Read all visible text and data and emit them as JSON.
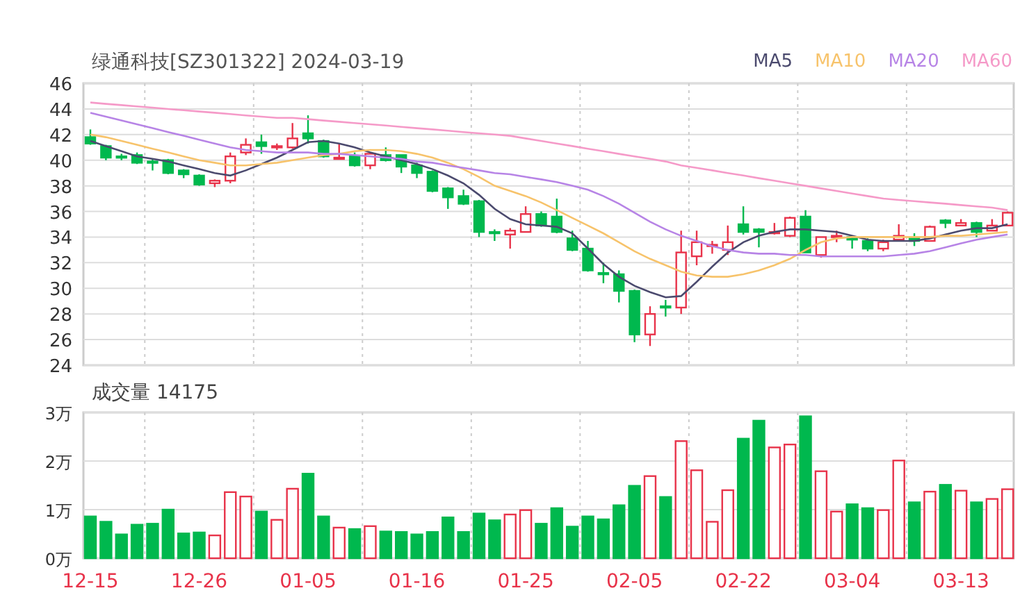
{
  "title": "绿通科技[SZ301322] 2024-03-19",
  "moving_averages": {
    "chart_data": {
      "type": "line",
      "ylim": [
        24,
        46
      ],
      "series": [
        {
          "name": "MA5",
          "color": "#4b4a6e",
          "values": [
            41.5,
            41.1,
            40.7,
            40.3,
            40.1,
            39.9,
            39.6,
            39.3,
            39.0,
            38.8,
            39.2,
            39.7,
            40.2,
            40.8,
            41.4,
            41.5,
            41.3,
            41.0,
            40.6,
            40.3,
            40.0,
            39.7,
            39.3,
            38.8,
            38.2,
            37.3,
            36.2,
            35.4,
            35.0,
            34.9,
            34.8,
            34.3,
            33.1,
            31.9,
            30.9,
            30.2,
            29.7,
            29.3,
            29.4,
            30.5,
            31.7,
            32.8,
            33.6,
            34.1,
            34.4,
            34.6,
            34.6,
            34.5,
            34.4,
            34.1,
            33.8,
            33.7,
            33.7,
            33.7,
            33.9,
            34.2,
            34.5,
            34.7,
            34.7,
            35.0
          ]
        },
        {
          "name": "MA10",
          "color": "#f7c36b",
          "values": [
            42.0,
            41.8,
            41.5,
            41.2,
            40.9,
            40.6,
            40.3,
            40.0,
            39.8,
            39.6,
            39.6,
            39.7,
            39.8,
            40.0,
            40.2,
            40.4,
            40.5,
            40.7,
            40.8,
            40.8,
            40.7,
            40.5,
            40.2,
            39.8,
            39.3,
            38.7,
            38.0,
            37.6,
            37.2,
            36.7,
            36.1,
            35.5,
            34.9,
            34.3,
            33.6,
            32.9,
            32.3,
            31.8,
            31.3,
            31.0,
            30.9,
            30.9,
            31.1,
            31.4,
            31.8,
            32.3,
            33.0,
            33.6,
            33.9,
            34.0,
            34.0,
            34.0,
            34.0,
            34.0,
            34.0,
            34.1,
            34.1,
            34.2,
            34.3,
            34.4
          ]
        },
        {
          "name": "MA20",
          "color": "#b784e6",
          "values": [
            43.7,
            43.4,
            43.1,
            42.8,
            42.5,
            42.2,
            41.9,
            41.6,
            41.3,
            41.0,
            40.8,
            40.7,
            40.6,
            40.6,
            40.6,
            40.5,
            40.5,
            40.4,
            40.3,
            40.2,
            40.1,
            39.9,
            39.8,
            39.6,
            39.4,
            39.2,
            39.0,
            38.9,
            38.7,
            38.5,
            38.3,
            38.0,
            37.7,
            37.2,
            36.6,
            35.9,
            35.2,
            34.6,
            34.1,
            33.7,
            33.3,
            33.0,
            32.8,
            32.7,
            32.7,
            32.6,
            32.6,
            32.5,
            32.5,
            32.5,
            32.5,
            32.5,
            32.6,
            32.7,
            32.9,
            33.2,
            33.5,
            33.8,
            34.0,
            34.2
          ]
        },
        {
          "name": "MA60",
          "color": "#f59ac8",
          "values": [
            44.5,
            44.4,
            44.3,
            44.2,
            44.1,
            44.0,
            43.9,
            43.8,
            43.7,
            43.6,
            43.5,
            43.4,
            43.3,
            43.3,
            43.2,
            43.1,
            43.0,
            42.9,
            42.8,
            42.7,
            42.6,
            42.5,
            42.4,
            42.3,
            42.2,
            42.1,
            42.0,
            41.9,
            41.7,
            41.5,
            41.3,
            41.1,
            40.9,
            40.7,
            40.5,
            40.3,
            40.1,
            39.9,
            39.6,
            39.4,
            39.2,
            39.0,
            38.8,
            38.6,
            38.4,
            38.2,
            38.0,
            37.8,
            37.6,
            37.4,
            37.2,
            37.0,
            36.9,
            36.8,
            36.7,
            36.6,
            36.5,
            36.4,
            36.3,
            36.1
          ]
        }
      ]
    }
  },
  "price_chart": {
    "chart_data": {
      "type": "candlestick",
      "grid": true,
      "ylim": [
        24,
        46
      ],
      "yticks": [
        24,
        26,
        28,
        30,
        32,
        34,
        36,
        38,
        40,
        42,
        44,
        46
      ],
      "ohlc": [
        [
          41.8,
          42.4,
          41.2,
          41.3
        ],
        [
          41.1,
          41.2,
          40.0,
          40.2
        ],
        [
          40.3,
          40.5,
          40.0,
          40.2
        ],
        [
          40.4,
          40.6,
          39.7,
          39.8
        ],
        [
          39.9,
          40.1,
          39.2,
          39.8
        ],
        [
          40.0,
          40.1,
          38.9,
          39.0
        ],
        [
          39.2,
          39.3,
          38.6,
          38.9
        ],
        [
          38.8,
          38.9,
          38.0,
          38.1
        ],
        [
          38.2,
          38.5,
          37.9,
          38.4
        ],
        [
          38.4,
          40.6,
          38.2,
          40.3
        ],
        [
          40.6,
          41.7,
          40.4,
          41.2
        ],
        [
          41.4,
          42.0,
          40.5,
          41.1
        ],
        [
          41.0,
          41.3,
          40.8,
          41.1
        ],
        [
          41.0,
          42.9,
          40.9,
          41.7
        ],
        [
          42.1,
          43.5,
          41.3,
          41.7
        ],
        [
          41.5,
          41.6,
          40.2,
          40.3
        ],
        [
          40.1,
          41.3,
          40.1,
          40.2
        ],
        [
          40.3,
          40.6,
          39.5,
          39.6
        ],
        [
          39.6,
          40.6,
          39.3,
          40.5
        ],
        [
          40.4,
          41.0,
          39.9,
          40.0
        ],
        [
          40.4,
          40.4,
          39.0,
          39.5
        ],
        [
          39.6,
          39.8,
          38.6,
          39.0
        ],
        [
          39.1,
          39.2,
          37.5,
          37.6
        ],
        [
          37.8,
          37.9,
          36.2,
          37.1
        ],
        [
          37.2,
          37.7,
          36.5,
          36.6
        ],
        [
          36.8,
          36.9,
          34.0,
          34.4
        ],
        [
          34.4,
          34.6,
          33.7,
          34.3
        ],
        [
          34.2,
          34.7,
          33.1,
          34.5
        ],
        [
          34.4,
          36.4,
          34.4,
          35.8
        ],
        [
          35.8,
          36.0,
          34.8,
          34.9
        ],
        [
          35.6,
          37.0,
          34.3,
          34.4
        ],
        [
          33.9,
          34.5,
          32.9,
          33.0
        ],
        [
          33.1,
          33.7,
          31.3,
          31.4
        ],
        [
          31.2,
          32.0,
          30.4,
          31.1
        ],
        [
          31.1,
          31.4,
          28.9,
          29.8
        ],
        [
          29.8,
          29.9,
          25.8,
          26.4
        ],
        [
          26.4,
          28.6,
          25.5,
          28.0
        ],
        [
          28.6,
          29.1,
          27.8,
          28.5
        ],
        [
          28.5,
          34.5,
          28.0,
          32.8
        ],
        [
          32.5,
          34.5,
          31.8,
          33.6
        ],
        [
          33.3,
          33.7,
          32.7,
          33.4
        ],
        [
          33.0,
          34.9,
          32.6,
          33.6
        ],
        [
          35.0,
          36.4,
          34.2,
          34.4
        ],
        [
          34.6,
          34.7,
          33.2,
          34.4
        ],
        [
          34.3,
          35.1,
          34.2,
          34.4
        ],
        [
          34.1,
          35.6,
          34.0,
          35.5
        ],
        [
          35.6,
          36.1,
          32.8,
          32.8
        ],
        [
          32.6,
          34.0,
          32.4,
          34.0
        ],
        [
          34.0,
          34.5,
          33.6,
          34.1
        ],
        [
          34.0,
          34.1,
          33.1,
          33.8
        ],
        [
          33.7,
          33.9,
          32.9,
          33.1
        ],
        [
          33.1,
          33.8,
          32.9,
          33.6
        ],
        [
          33.8,
          35.0,
          33.8,
          34.1
        ],
        [
          33.9,
          34.3,
          33.3,
          33.7
        ],
        [
          33.7,
          34.9,
          33.7,
          34.8
        ],
        [
          35.3,
          35.4,
          34.7,
          35.1
        ],
        [
          34.9,
          35.4,
          34.9,
          35.1
        ],
        [
          35.1,
          35.2,
          34.0,
          34.4
        ],
        [
          34.5,
          35.4,
          34.5,
          34.9
        ],
        [
          34.9,
          36.0,
          34.9,
          35.9
        ]
      ]
    }
  },
  "volume_chart": {
    "chart_data": {
      "type": "bar",
      "grid": true,
      "title": "成交量 14175",
      "categories": [
        "12-15",
        null,
        null,
        null,
        null,
        null,
        null,
        "12-26",
        null,
        null,
        null,
        null,
        null,
        null,
        "01-05",
        null,
        null,
        null,
        null,
        null,
        null,
        "01-16",
        null,
        null,
        null,
        null,
        null,
        null,
        "01-25",
        null,
        null,
        null,
        null,
        null,
        null,
        "02-05",
        null,
        null,
        null,
        null,
        null,
        null,
        "02-22",
        null,
        null,
        null,
        null,
        null,
        null,
        "03-04",
        null,
        null,
        null,
        null,
        null,
        null,
        "03-13",
        null,
        null,
        null
      ],
      "ylim": [
        0,
        3
      ],
      "yticks": [
        {
          "value": 0,
          "label": "0万"
        },
        {
          "value": 1,
          "label": "1万"
        },
        {
          "value": 2,
          "label": "2万"
        },
        {
          "value": 3,
          "label": "3万"
        }
      ],
      "values": [
        0.86,
        0.75,
        0.49,
        0.69,
        0.71,
        1.0,
        0.51,
        0.53,
        0.47,
        1.36,
        1.27,
        0.96,
        0.79,
        1.43,
        1.74,
        0.86,
        0.63,
        0.6,
        0.66,
        0.55,
        0.54,
        0.49,
        0.54,
        0.84,
        0.54,
        0.92,
        0.78,
        0.9,
        0.99,
        0.71,
        1.03,
        0.65,
        0.86,
        0.8,
        1.09,
        1.49,
        1.69,
        1.26,
        2.41,
        1.81,
        0.75,
        1.4,
        2.46,
        2.83,
        2.28,
        2.34,
        2.92,
        1.79,
        0.96,
        1.11,
        1.03,
        0.99,
        2.01,
        1.15,
        1.37,
        1.51,
        1.39,
        1.15,
        1.22,
        1.42
      ]
    }
  }
}
